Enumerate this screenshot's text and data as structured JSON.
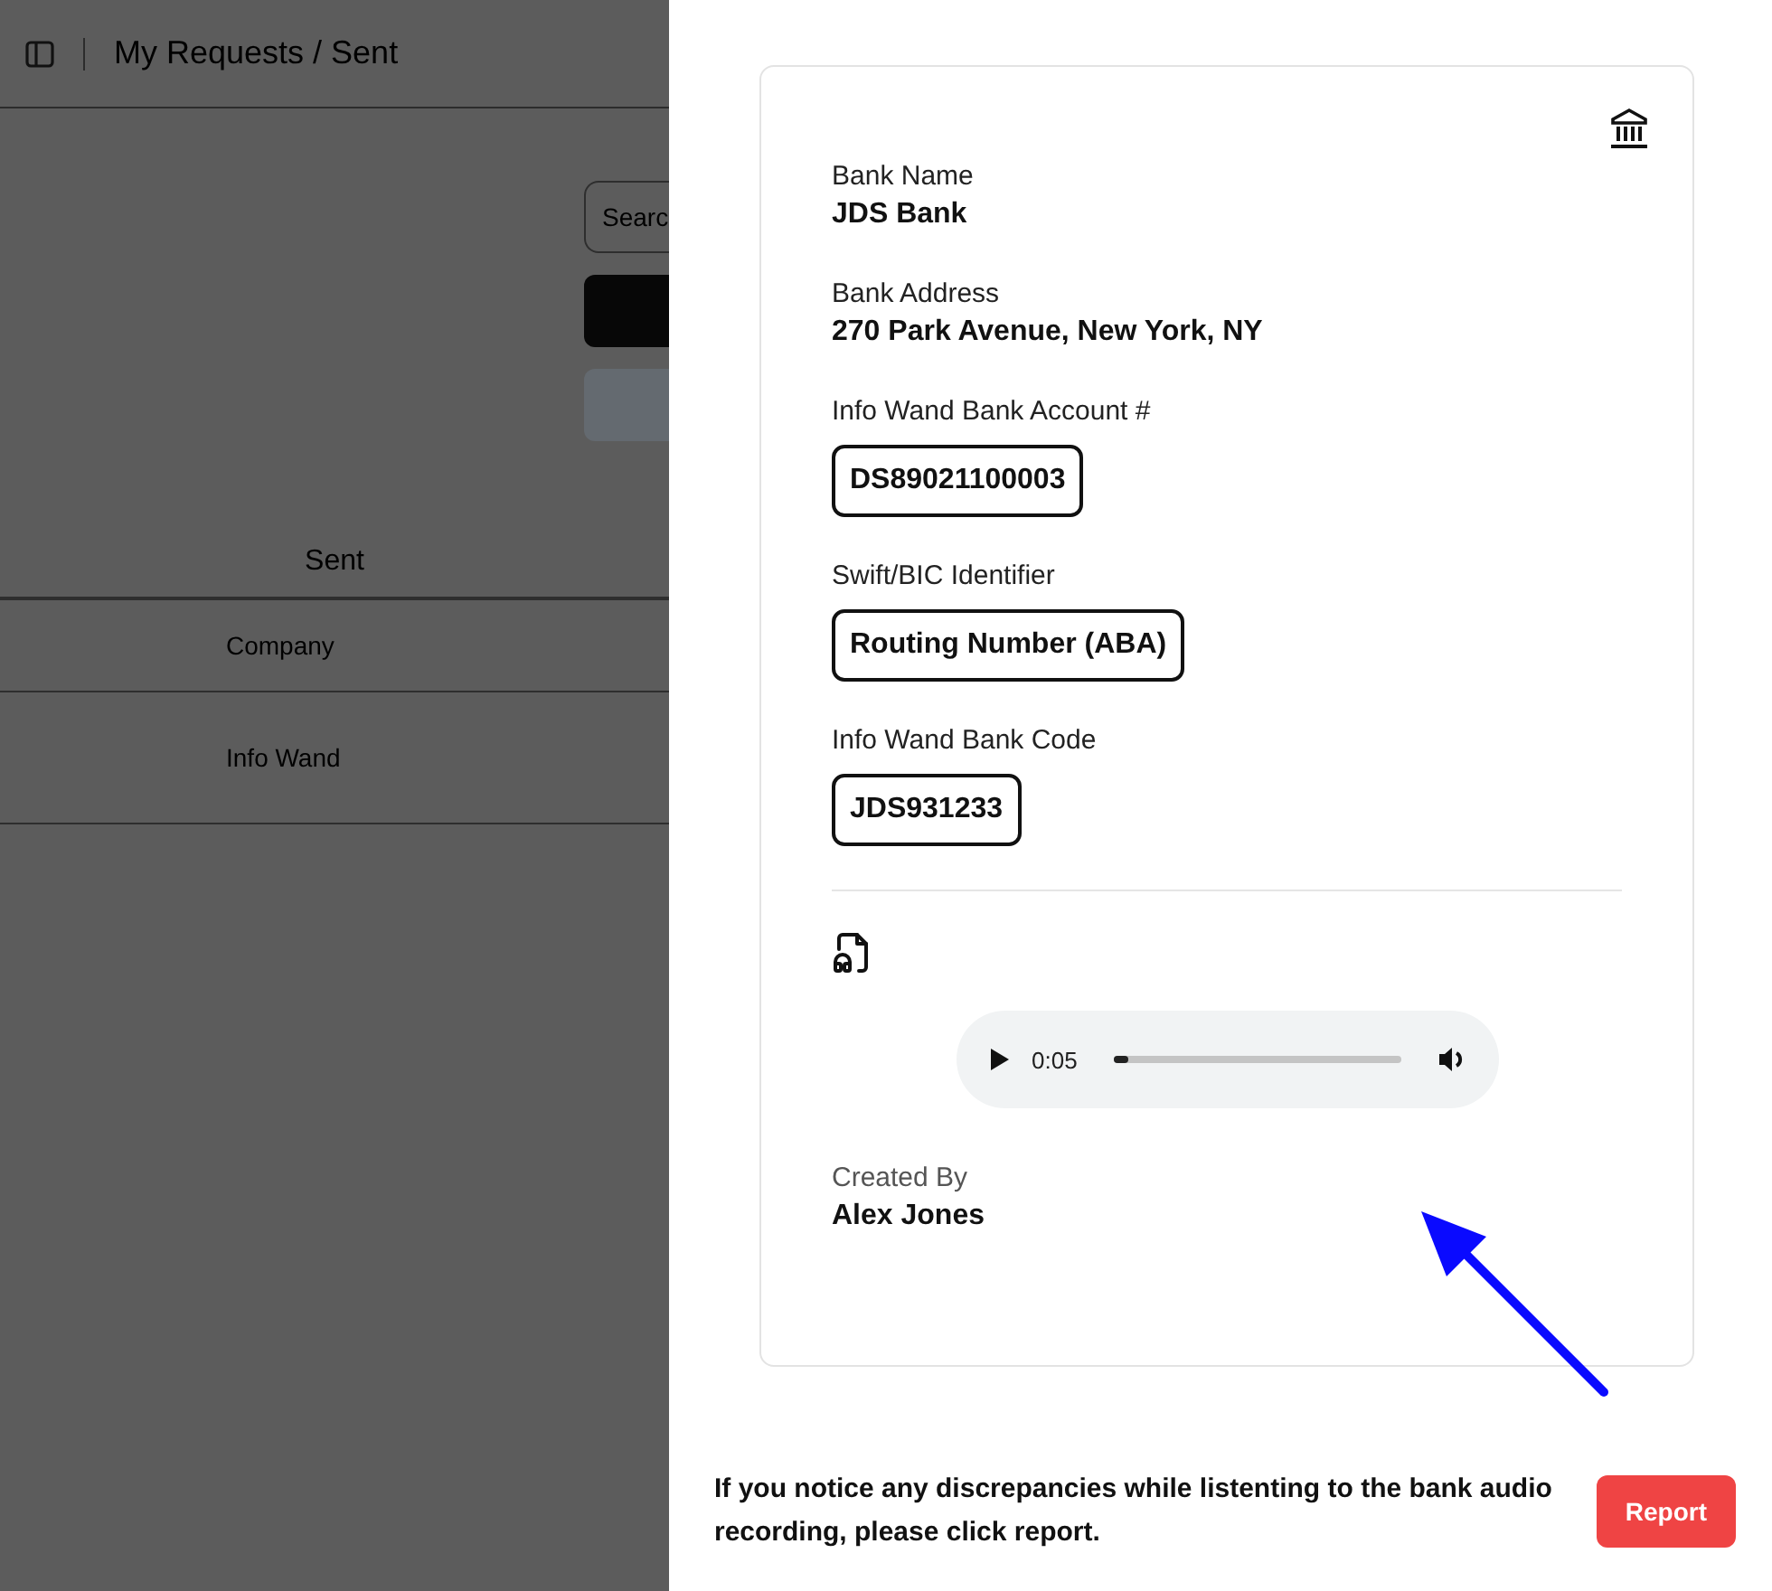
{
  "header": {
    "title": "My Requests / Sent"
  },
  "background": {
    "search": {
      "placeholder": "Searc"
    },
    "tabs": [
      {
        "label": "Sent",
        "selected": true
      }
    ],
    "table": {
      "columns": [
        "Company"
      ],
      "rows": [
        [
          "Info Wand"
        ]
      ]
    }
  },
  "drawer": {
    "details": [
      {
        "label": "Bank Name",
        "value": "JDS Bank",
        "kind": "plain"
      },
      {
        "label": "Bank Address",
        "value": "270 Park Avenue, New York, NY",
        "kind": "plain"
      },
      {
        "label": "Info Wand Bank Account #",
        "value": "DS89021100003",
        "kind": "boxed"
      },
      {
        "label": "Swift/BIC Identifier",
        "value": "Routing Number (ABA)",
        "kind": "boxed"
      },
      {
        "label": "Info Wand Bank Code",
        "value": "JDS931233",
        "kind": "boxed"
      }
    ],
    "audio": {
      "time": "0:05",
      "level": 0.02
    },
    "created_by": {
      "label": "Created By",
      "value": "Alex Jones"
    },
    "notice": "If you notice any discrepancies while listenting to the bank audio recording, please click report.",
    "report_button": "Report"
  }
}
